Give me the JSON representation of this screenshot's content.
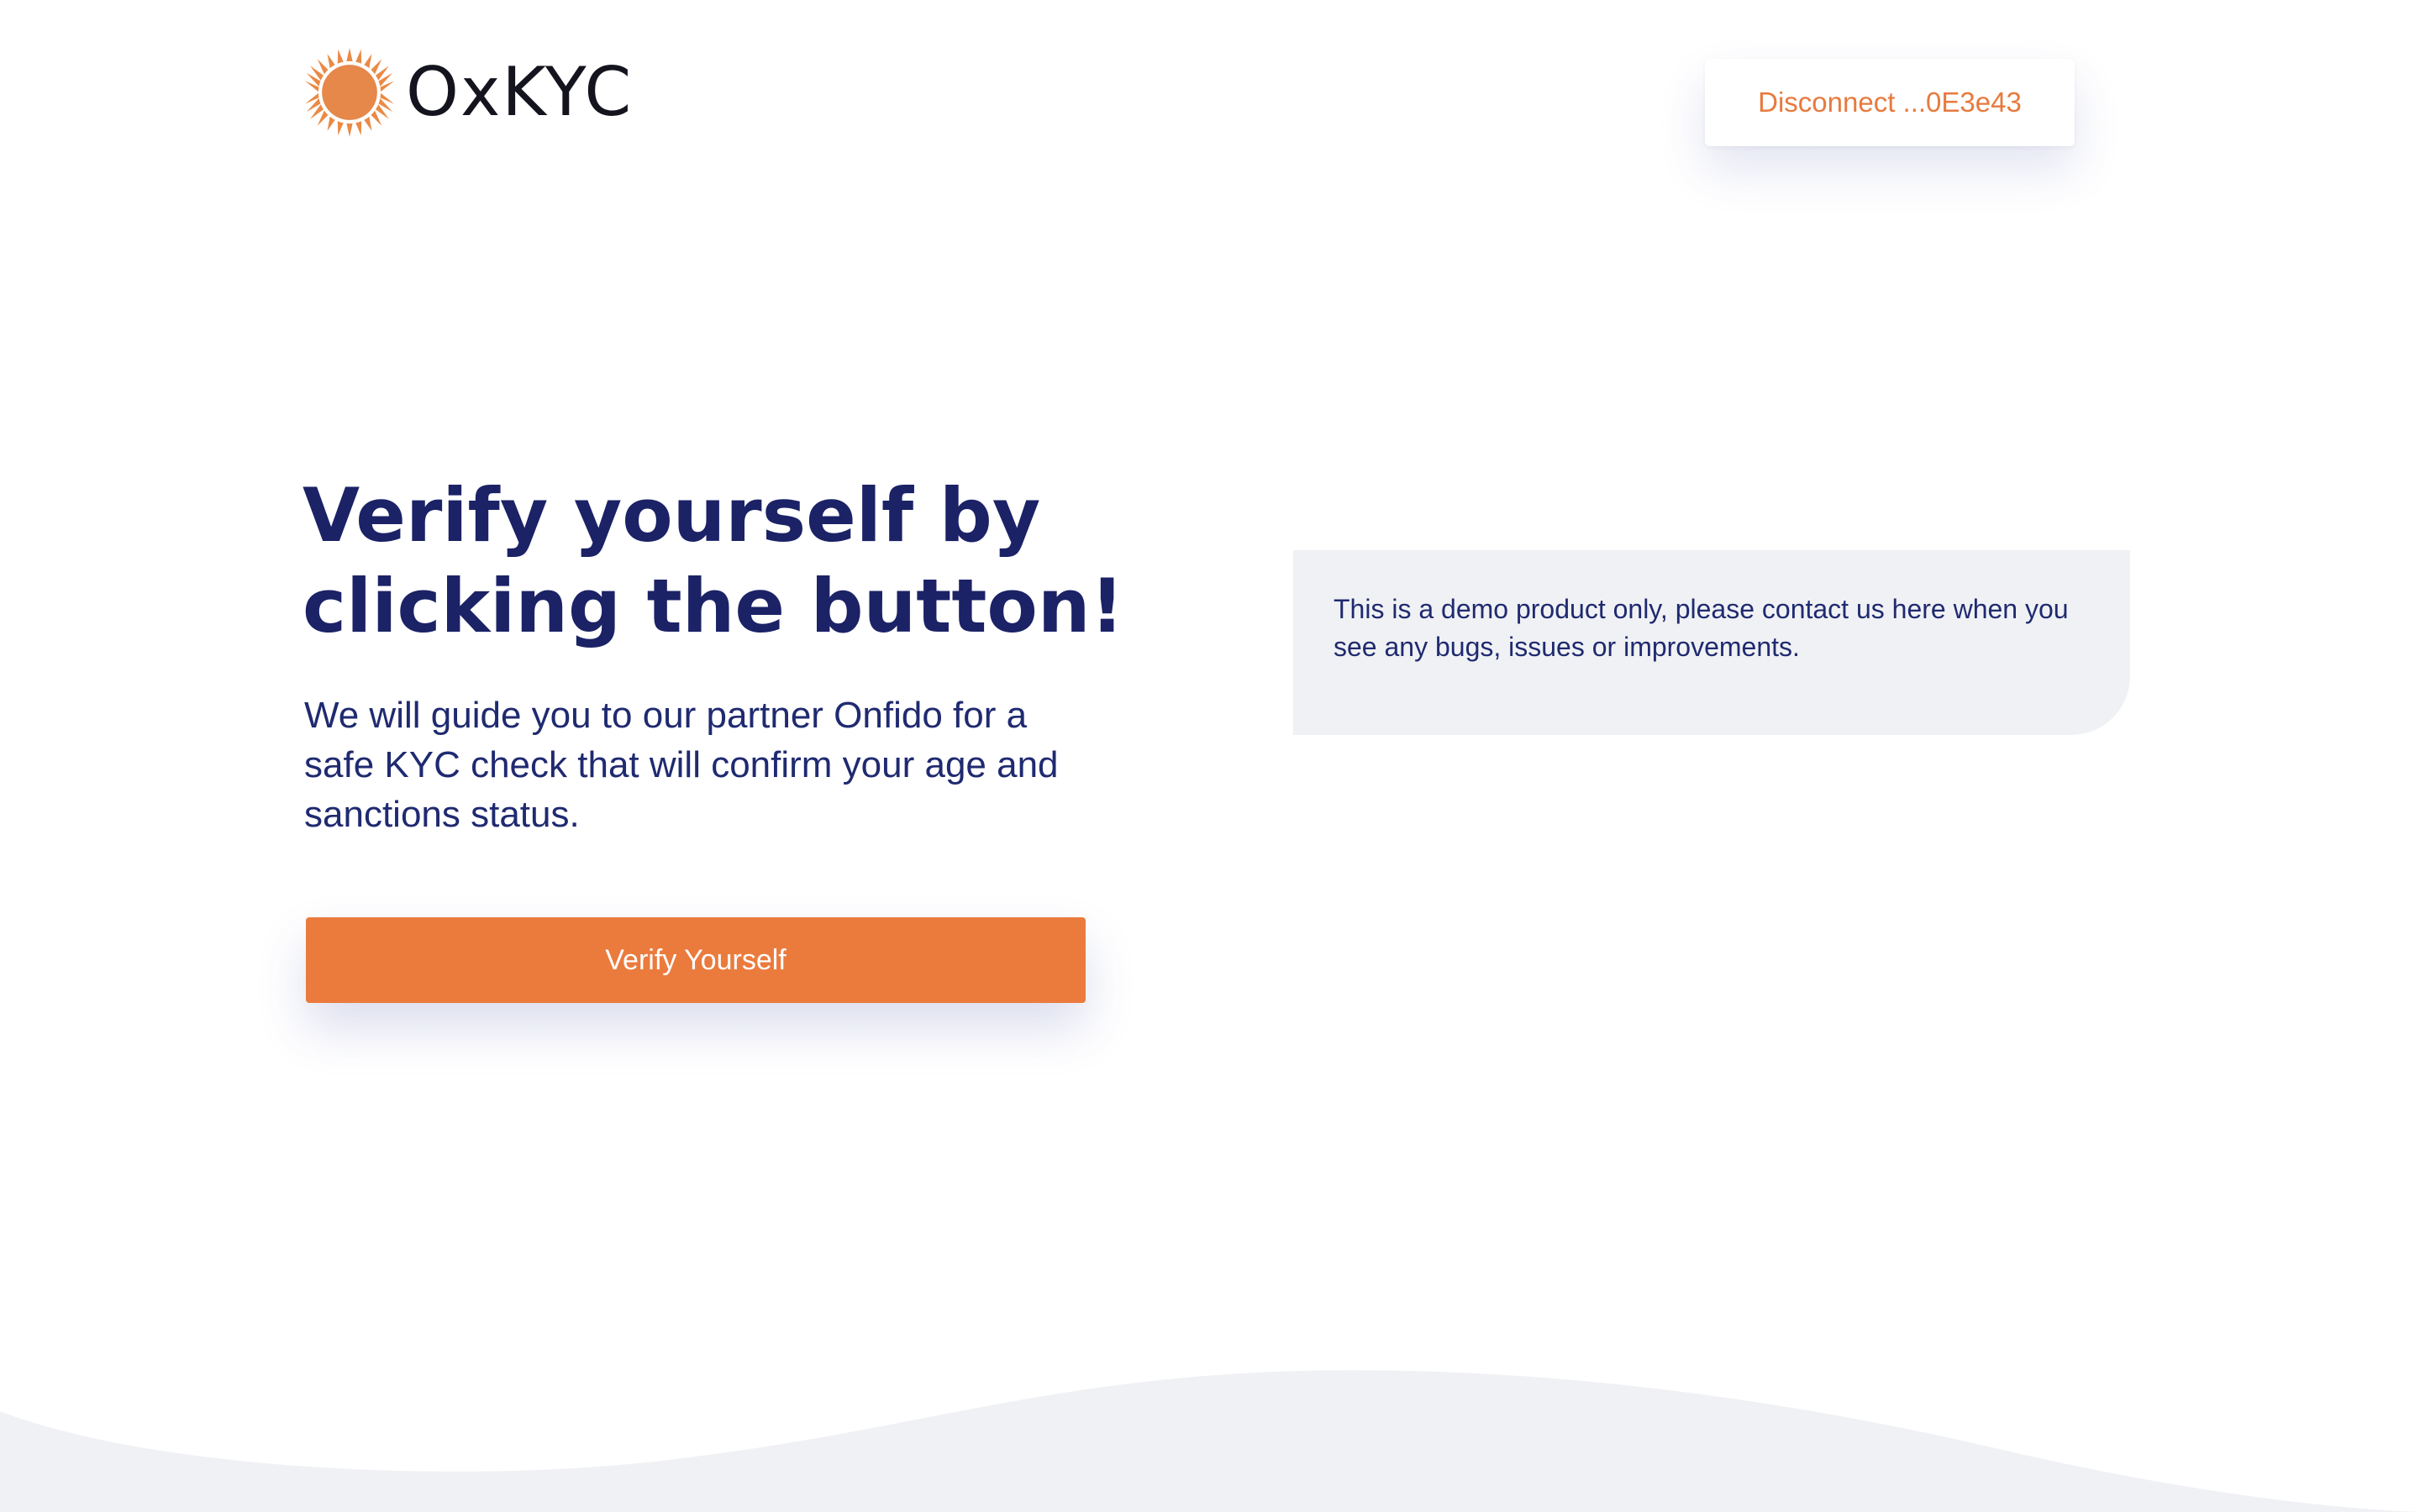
{
  "brand": {
    "name": "OxKYC",
    "accent_color": "#eb7b3d",
    "text_color": "#1b2266"
  },
  "header": {
    "logo_icon": "sun-icon",
    "disconnect_label": "Disconnect ...0E3e43"
  },
  "hero": {
    "title": "Verify yourself by clicking the button!",
    "description": "We will guide you to our partner Onfido for a safe KYC check that will confirm your age and sanctions status.",
    "button_label": "Verify Yourself"
  },
  "notice": {
    "text": "This is a demo product only, please contact us here when you see any bugs, issues or improvements."
  }
}
